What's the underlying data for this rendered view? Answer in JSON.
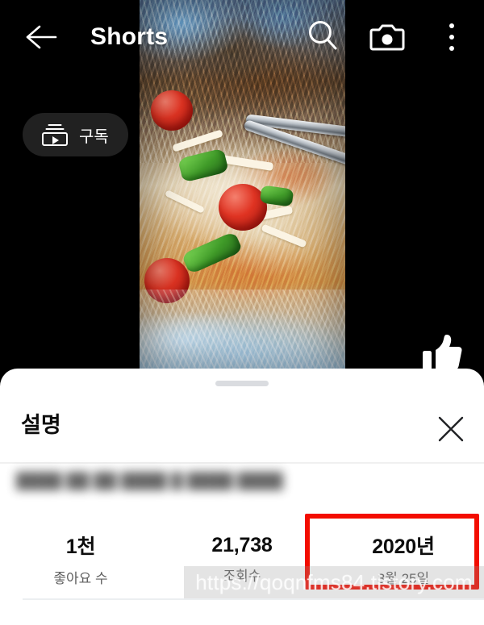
{
  "app": {
    "screen_title": "Shorts"
  },
  "top_bar": {
    "back_icon": "back-arrow-icon",
    "title": "Shorts",
    "search_icon": "search-icon",
    "camera_icon": "camera-icon",
    "menu_icon": "more-vertical-icon"
  },
  "video": {
    "subscribe_label": "구독",
    "subscribe_icon": "subscriptions-icon",
    "like_icon": "thumbs-up-icon"
  },
  "sheet": {
    "title": "설명",
    "close_icon": "close-x-icon",
    "drag_handle": "drag-handle",
    "description": "████ ██ ██ ████ █ ████ ████",
    "stats": [
      {
        "value": "1천",
        "label": "좋아요 수"
      },
      {
        "value": "21,738",
        "label": "조회수"
      },
      {
        "value": "2020년",
        "label": "3월 25일"
      }
    ]
  },
  "annotation": {
    "highlight_color": "#f30d00",
    "highlight_target": "upload-date-stat"
  },
  "watermark": {
    "text": "https://qoqnfms84.tistory.com"
  }
}
